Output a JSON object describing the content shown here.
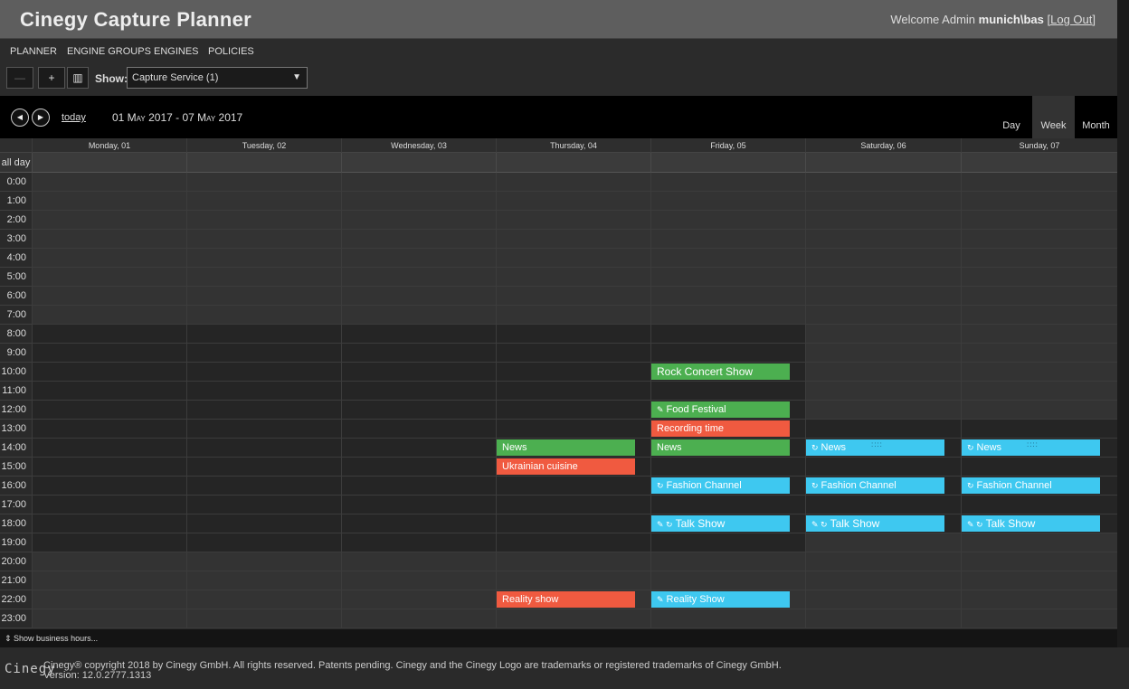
{
  "header": {
    "title": "Cinegy Capture Planner",
    "welcome_prefix": "Welcome Admin",
    "user": "munich\\bas",
    "logout": "[Log Out]"
  },
  "nav": {
    "items": [
      "PLANNER",
      "ENGINE GROUPS",
      "ENGINES",
      "POLICIES"
    ]
  },
  "toolbar": {
    "minus": "—",
    "plus": "+",
    "calendar_icon": "▥",
    "show_label": "Show:",
    "show_value": "Capture Service (1)",
    "dropdown_arrow": "▼"
  },
  "calendar": {
    "prev": "◀",
    "next": "▶",
    "today": "today",
    "range": "01 May 2017 - 07 May 2017",
    "views": [
      "Day",
      "Week",
      "Month"
    ],
    "active_view": "Week",
    "days": [
      "Monday, 01",
      "Tuesday, 02",
      "Wednesday, 03",
      "Thursday, 04",
      "Friday, 05",
      "Saturday, 06",
      "Sunday, 07"
    ],
    "allday_label": "all day",
    "hours": [
      "0:00",
      "1:00",
      "2:00",
      "3:00",
      "4:00",
      "5:00",
      "6:00",
      "7:00",
      "8:00",
      "9:00",
      "10:00",
      "11:00",
      "12:00",
      "13:00",
      "14:00",
      "15:00",
      "16:00",
      "17:00",
      "18:00",
      "19:00",
      "20:00",
      "21:00",
      "22:00",
      "23:00"
    ]
  },
  "events": [
    {
      "day": 4,
      "hour": 10,
      "title": "Rock Concert Show",
      "color": "green",
      "big": true,
      "icons": ""
    },
    {
      "day": 4,
      "hour": 12,
      "title": "Food Festival",
      "color": "green",
      "big": false,
      "icons": "✎"
    },
    {
      "day": 4,
      "hour": 13,
      "title": "Recording time",
      "color": "red",
      "big": false,
      "icons": ""
    },
    {
      "day": 3,
      "hour": 14,
      "title": "News",
      "color": "green",
      "big": false,
      "icons": ""
    },
    {
      "day": 4,
      "hour": 14,
      "title": "News",
      "color": "green",
      "big": false,
      "icons": ""
    },
    {
      "day": 5,
      "hour": 14,
      "title": "News",
      "color": "blue",
      "big": false,
      "icons": "↻",
      "dots": "::::"
    },
    {
      "day": 6,
      "hour": 14,
      "title": "News",
      "color": "blue",
      "big": false,
      "icons": "↻",
      "dots": "::::"
    },
    {
      "day": 3,
      "hour": 15,
      "title": "Ukrainian cuisine",
      "color": "red",
      "big": false,
      "icons": ""
    },
    {
      "day": 4,
      "hour": 16,
      "title": "Fashion Channel",
      "color": "blue",
      "big": false,
      "icons": "↻"
    },
    {
      "day": 5,
      "hour": 16,
      "title": "Fashion Channel",
      "color": "blue",
      "big": false,
      "icons": "↻"
    },
    {
      "day": 6,
      "hour": 16,
      "title": "Fashion Channel",
      "color": "blue",
      "big": false,
      "icons": "↻"
    },
    {
      "day": 4,
      "hour": 18,
      "title": "Talk Show",
      "color": "blue",
      "big": true,
      "icons": "✎ ↻"
    },
    {
      "day": 5,
      "hour": 18,
      "title": "Talk Show",
      "color": "blue",
      "big": true,
      "icons": "✎ ↻"
    },
    {
      "day": 6,
      "hour": 18,
      "title": "Talk Show",
      "color": "blue",
      "big": true,
      "icons": "✎ ↻"
    },
    {
      "day": 3,
      "hour": 22,
      "title": "Reality show",
      "color": "red",
      "big": false,
      "icons": ""
    },
    {
      "day": 4,
      "hour": 22,
      "title": "Reality Show",
      "color": "blue",
      "big": false,
      "icons": "✎"
    }
  ],
  "footer": {
    "show_business_hours": "⇕ Show business hours...",
    "logo": "Cinegy",
    "copyright": "Cinegy® copyright 2018 by Cinegy GmbH. All rights reserved. Patents pending. Cinegy and the Cinegy Logo are trademarks or registered trademarks of Cinegy GmbH.",
    "version": "Version: 12.0.2777.1313"
  }
}
